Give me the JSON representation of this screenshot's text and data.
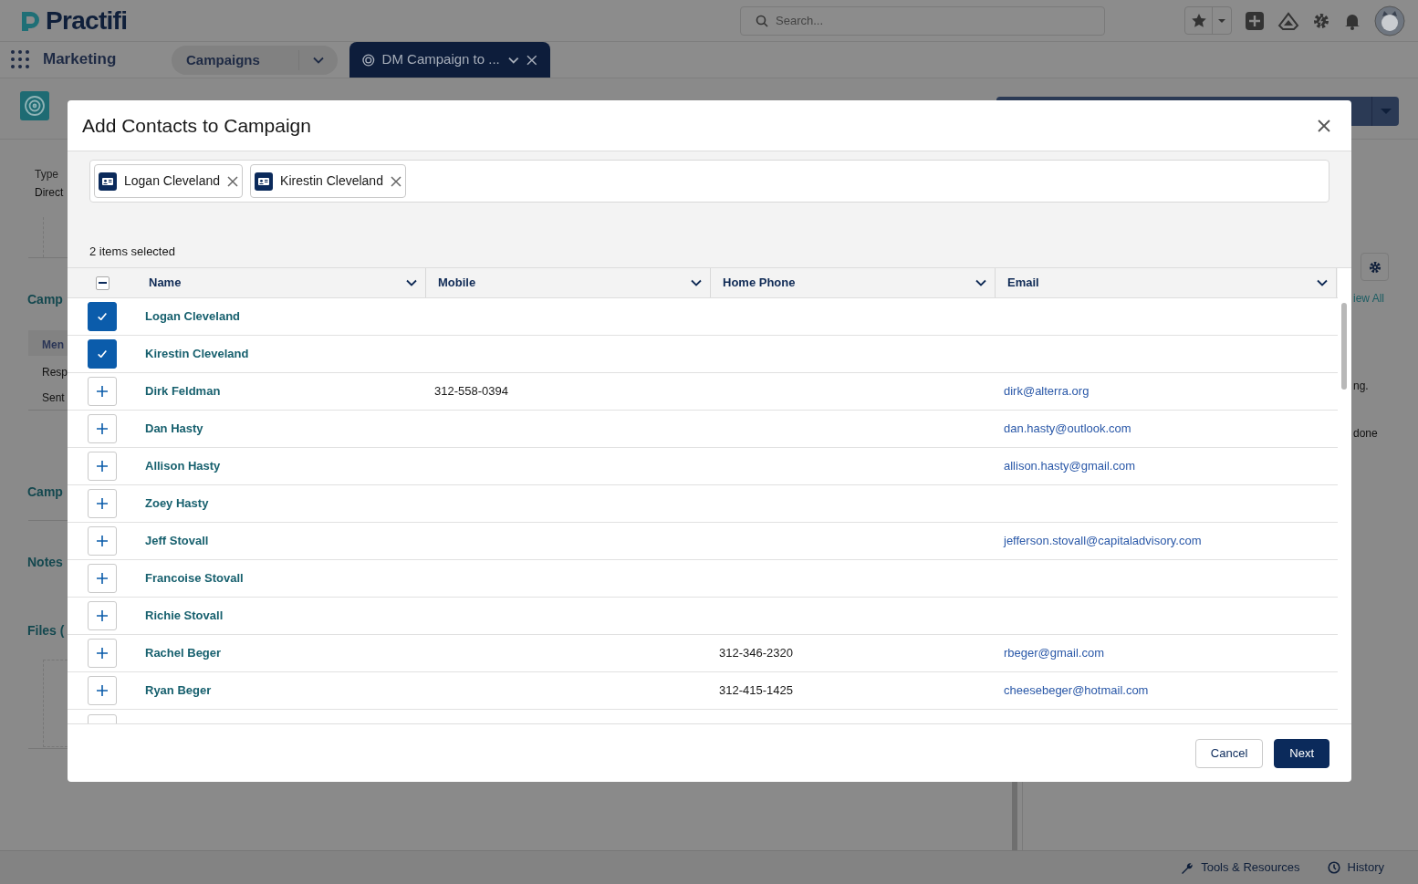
{
  "app": {
    "logo": "Practifi",
    "search_placeholder": "Search...",
    "app_name": "Marketing",
    "nav_item": "Campaigns",
    "tabs": [
      {
        "label": "DM Campaign to ...",
        "selected": true
      }
    ]
  },
  "background": {
    "left_fragments": [
      {
        "text": "Type",
        "kind": "label"
      },
      {
        "text": "Direct",
        "kind": "value"
      },
      {
        "text": "Camp",
        "kind": "heading"
      },
      {
        "text": "Men",
        "kind": "tab"
      },
      {
        "text": "Resp",
        "kind": "value"
      },
      {
        "text": "Sent",
        "kind": "value"
      },
      {
        "text": "Camp",
        "kind": "heading"
      },
      {
        "text": "Notes",
        "kind": "heading"
      },
      {
        "text": "Files (",
        "kind": "heading"
      }
    ],
    "right_fragments": [
      {
        "text": "iew All",
        "kind": "link"
      },
      {
        "text": "ng.",
        "kind": "value"
      },
      {
        "text": "done",
        "kind": "value"
      }
    ]
  },
  "modal": {
    "title": "Add Contacts to Campaign",
    "pills": [
      "Logan Cleveland",
      "Kirestin Cleveland"
    ],
    "selection_count": "2 items selected",
    "header_checkbox": {
      "indeterminate": true
    },
    "columns": [
      "Name",
      "Mobile",
      "Home Phone",
      "Email"
    ],
    "rows": [
      {
        "name": "Logan Cleveland",
        "selected": true
      },
      {
        "name": "Kirestin Cleveland",
        "selected": true
      },
      {
        "name": "Dirk Feldman",
        "mobile": "312-558-0394",
        "email": "dirk@alterra.org",
        "selected": false
      },
      {
        "name": "Dan Hasty",
        "email": "dan.hasty@outlook.com",
        "selected": false
      },
      {
        "name": "Allison Hasty",
        "email": "allison.hasty@gmail.com",
        "selected": false
      },
      {
        "name": "Zoey Hasty",
        "selected": false
      },
      {
        "name": "Jeff Stovall",
        "email": "jefferson.stovall@capitaladvisory.com",
        "selected": false
      },
      {
        "name": "Francoise Stovall",
        "selected": false
      },
      {
        "name": "Richie Stovall",
        "selected": false
      },
      {
        "name": "Rachel Beger",
        "home_phone": "312-346-2320",
        "email": "rbeger@gmail.com",
        "selected": false
      },
      {
        "name": "Ryan Beger",
        "home_phone": "312-415-1425",
        "email": "cheesebeger@hotmail.com",
        "selected": false
      }
    ],
    "buttons": [
      {
        "label": "Cancel",
        "kind": "neutral"
      },
      {
        "label": "Next",
        "kind": "brand"
      }
    ]
  },
  "utility_bar": [
    {
      "label": "Tools & Resources",
      "kind": "wrench"
    },
    {
      "label": "History",
      "kind": "clock"
    }
  ]
}
